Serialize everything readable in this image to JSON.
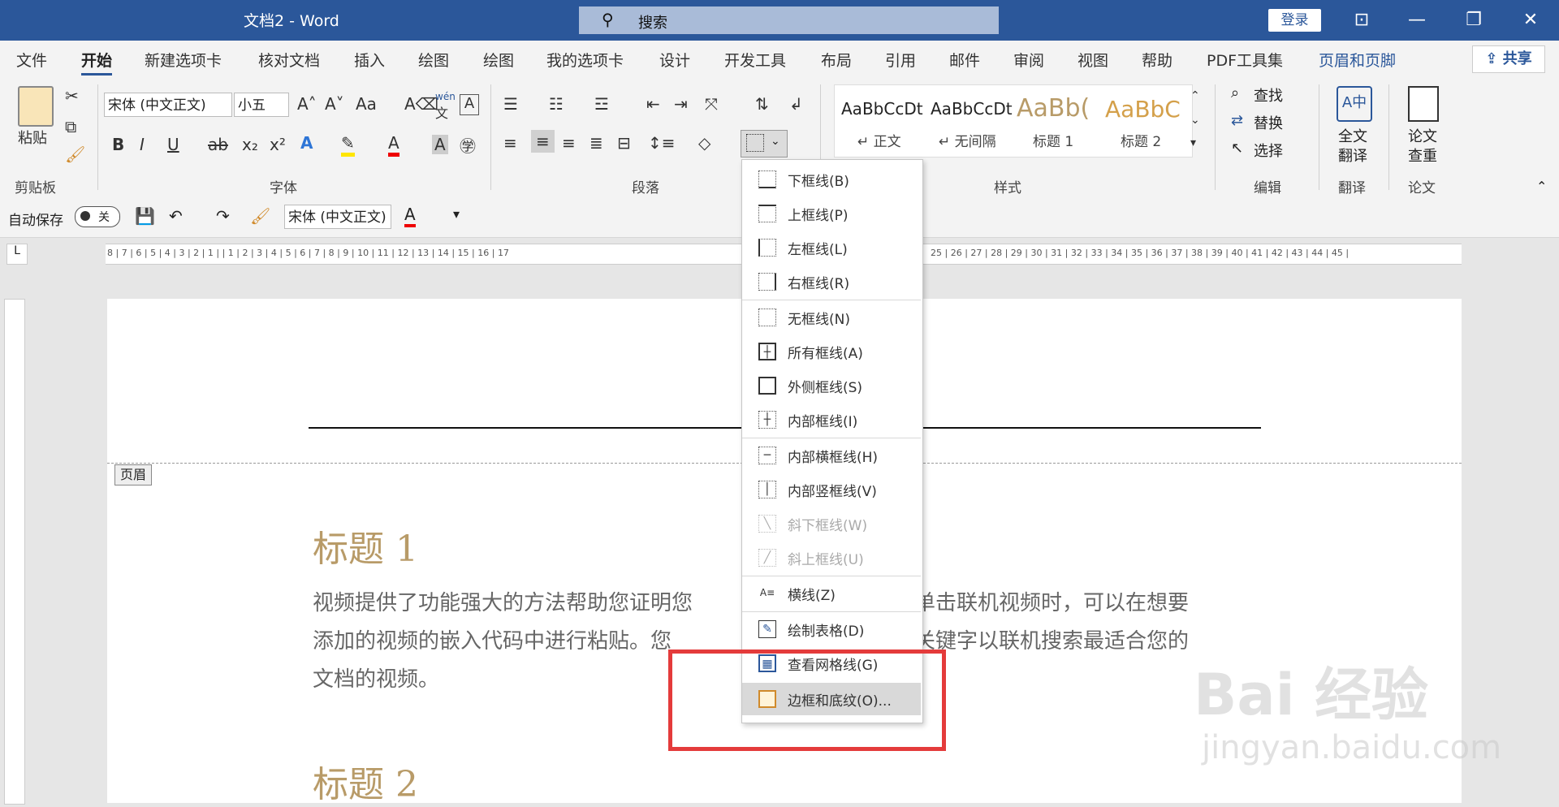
{
  "titlebar": {
    "doc_title": "文档2  -  Word",
    "search_placeholder": "搜索",
    "login": "登录"
  },
  "tabs": [
    "文件",
    "开始",
    "新建选项卡",
    "核对文档",
    "插入",
    "绘图",
    "绘图",
    "我的选项卡",
    "设计",
    "开发工具",
    "布局",
    "引用",
    "邮件",
    "审阅",
    "视图",
    "帮助",
    "PDF工具集",
    "页眉和页脚"
  ],
  "share": "共享",
  "ribbon": {
    "clipboard": {
      "paste": "粘贴",
      "group": "剪贴板"
    },
    "font": {
      "name": "宋体 (中文正文)",
      "size": "小五",
      "group": "字体",
      "wen": "wén",
      "wen_char": "文"
    },
    "paragraph": {
      "group": "段落"
    },
    "styles": {
      "group": "样式",
      "items": [
        {
          "sample": "AaBbCcDt",
          "name": "↵ 正文"
        },
        {
          "sample": "AaBbCcDt",
          "name": "↵ 无间隔"
        },
        {
          "sample": "AaBb(",
          "name": "标题 1"
        },
        {
          "sample": "AaBbC",
          "name": "标题 2"
        }
      ]
    },
    "editing": {
      "find": "查找",
      "replace": "替换",
      "select": "选择",
      "group": "编辑"
    },
    "translate": {
      "label1": "全文",
      "label2": "翻译",
      "group": "翻译"
    },
    "paper": {
      "label1": "论文",
      "label2": "查重",
      "group": "论文"
    }
  },
  "qat": {
    "autosave": "自动保存",
    "toggle": "关",
    "font": "宋体 (中文正文)"
  },
  "ruler": {
    "left": "8 | 7 | 6 | 5 | 4 | 3 | 2 | 1 |   | 1 | 2 | 3 | 4 | 5 | 6 | 7 | 8 | 9 | 10 | 11 | 12 | 13 | 14 | 15 | 16 | 17",
    "right": "25 | 26 | 27 | 28 | 29 | 30 | 31 | 32 | 33 | 34 | 35 | 36 | 37 |  38 | 39 | 40 | 41 | 42 | 43 | 44 | 45 |"
  },
  "document": {
    "header_tag": "页眉",
    "heading1": "标题 1",
    "para_line1": "视频提供了功能强大的方法帮助您证明您",
    "para_line1_right": "单击联机视频时，可以在想要",
    "para_line2": "添加的视频的嵌入代码中进行粘贴。您",
    "para_line2_right": "关键字以联机搜索最适合您的",
    "para_line3": "文档的视频。",
    "heading2": "标题 2"
  },
  "border_menu": [
    {
      "label": "下框线(B)",
      "enabled": true
    },
    {
      "label": "上框线(P)",
      "enabled": true
    },
    {
      "label": "左框线(L)",
      "enabled": true
    },
    {
      "label": "右框线(R)",
      "enabled": true
    },
    {
      "label": "无框线(N)",
      "enabled": true
    },
    {
      "label": "所有框线(A)",
      "enabled": true
    },
    {
      "label": "外侧框线(S)",
      "enabled": true
    },
    {
      "label": "内部框线(I)",
      "enabled": true
    },
    {
      "label": "内部横框线(H)",
      "enabled": true
    },
    {
      "label": "内部竖框线(V)",
      "enabled": true
    },
    {
      "label": "斜下框线(W)",
      "enabled": false
    },
    {
      "label": "斜上框线(U)",
      "enabled": false
    },
    {
      "label": "横线(Z)",
      "enabled": true
    },
    {
      "label": "绘制表格(D)",
      "enabled": true
    },
    {
      "label": "查看网格线(G)",
      "enabled": true
    },
    {
      "label": "边框和底纹(O)...",
      "enabled": true,
      "highlighted": true
    }
  ],
  "watermark": {
    "brand": "Bai 经验",
    "url": "jingyan.baidu.com"
  },
  "colors": {
    "titlebar": "#2b579a",
    "accent_red": "#e43b3b",
    "heading": "#b89b68"
  }
}
